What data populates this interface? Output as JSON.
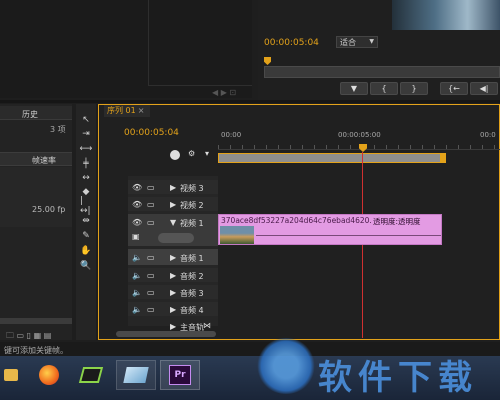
{
  "monitor": {
    "timecode": "00:00:05:04",
    "fit": "适合"
  },
  "project": {
    "tab_history": "历史",
    "count": "3 项",
    "col_framerate": "帧速率",
    "framerate": "25.00 fp"
  },
  "sequence": {
    "tab": "序列 01",
    "timecode": "00:00:05:04",
    "ruler_start": "00:00",
    "ruler_mid": "00:00:05:00",
    "ruler_end": "00:0"
  },
  "tracks": {
    "video": [
      "视频 3",
      "视频 2",
      "视频 1"
    ],
    "audio": [
      "音频 1",
      "音频 2",
      "音频 3",
      "音频 4"
    ],
    "master": "主音轨"
  },
  "clip": {
    "name": "370ace8df53227a204d64c76ebad4620.jpg",
    "opacity": "透明度:透明度"
  },
  "status": {
    "text": "键可添加关键帧。"
  },
  "taskbar": {
    "premiere": "Pr"
  },
  "watermark": {
    "text": "软件下载"
  },
  "colors": {
    "accent": "#e3a21a",
    "clip": "#e39be3",
    "playhead": "#d03030"
  }
}
